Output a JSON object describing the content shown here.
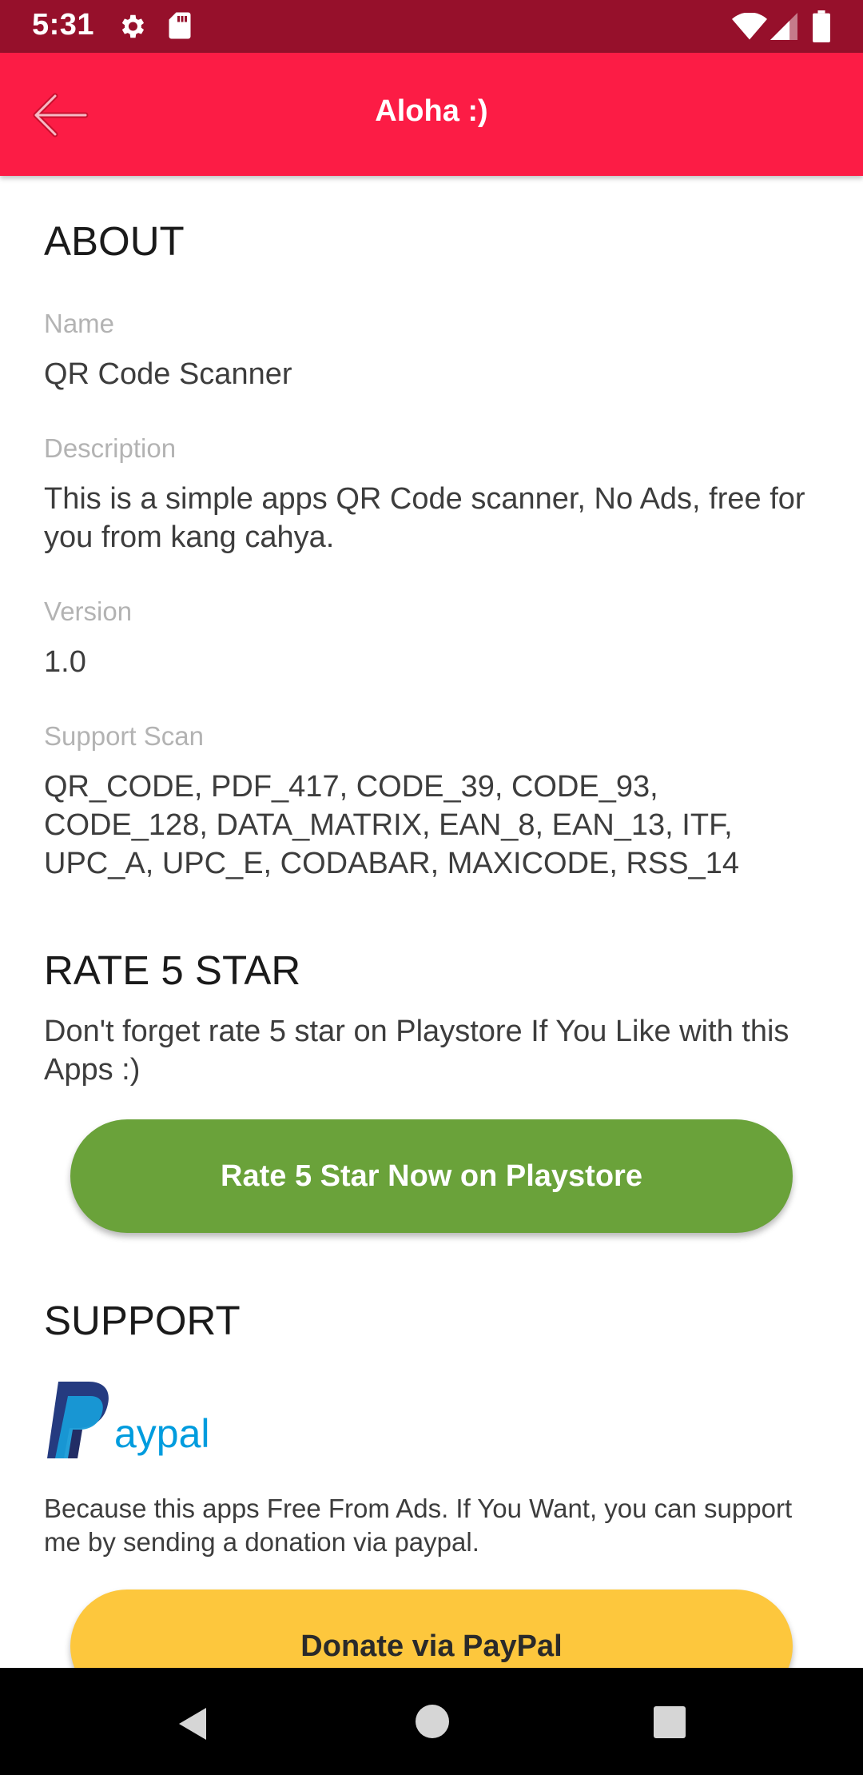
{
  "status_bar": {
    "time": "5:31",
    "icons": [
      "gear-icon",
      "sd-card-icon",
      "wifi-icon",
      "signal-icon",
      "battery-icon"
    ]
  },
  "app_bar": {
    "title": "Aloha :)",
    "background": "#fc1c45",
    "back_icon": "arrow-left-icon"
  },
  "about": {
    "heading": "ABOUT",
    "name_label": "Name",
    "name_value": "QR Code Scanner",
    "description_label": "Description",
    "description_value": "This is a simple apps QR Code scanner, No Ads, free for you from kang cahya.",
    "version_label": "Version",
    "version_value": "1.0",
    "support_scan_label": "Support Scan",
    "support_scan_value": "QR_CODE, PDF_417, CODE_39, CODE_93, CODE_128, DATA_MATRIX, EAN_8, EAN_13, ITF, UPC_A, UPC_E, CODABAR, MAXICODE, RSS_14"
  },
  "rate": {
    "heading": "RATE 5 STAR",
    "text": "Don't forget rate 5 star on Playstore If You Like with this Apps :)",
    "button_label": "Rate 5 Star Now on Playstore",
    "button_color": "#6aa23a"
  },
  "support": {
    "heading": "SUPPORT",
    "paypal_logo_text": "aypal",
    "text": "Because this apps Free From Ads. If You Want, you can support me by sending a donation via paypal.",
    "button_label": "Donate via PayPal",
    "button_color": "#fdc73d"
  },
  "nav_bar": {
    "icons": [
      "nav-back-icon",
      "nav-home-icon",
      "nav-recents-icon"
    ]
  }
}
